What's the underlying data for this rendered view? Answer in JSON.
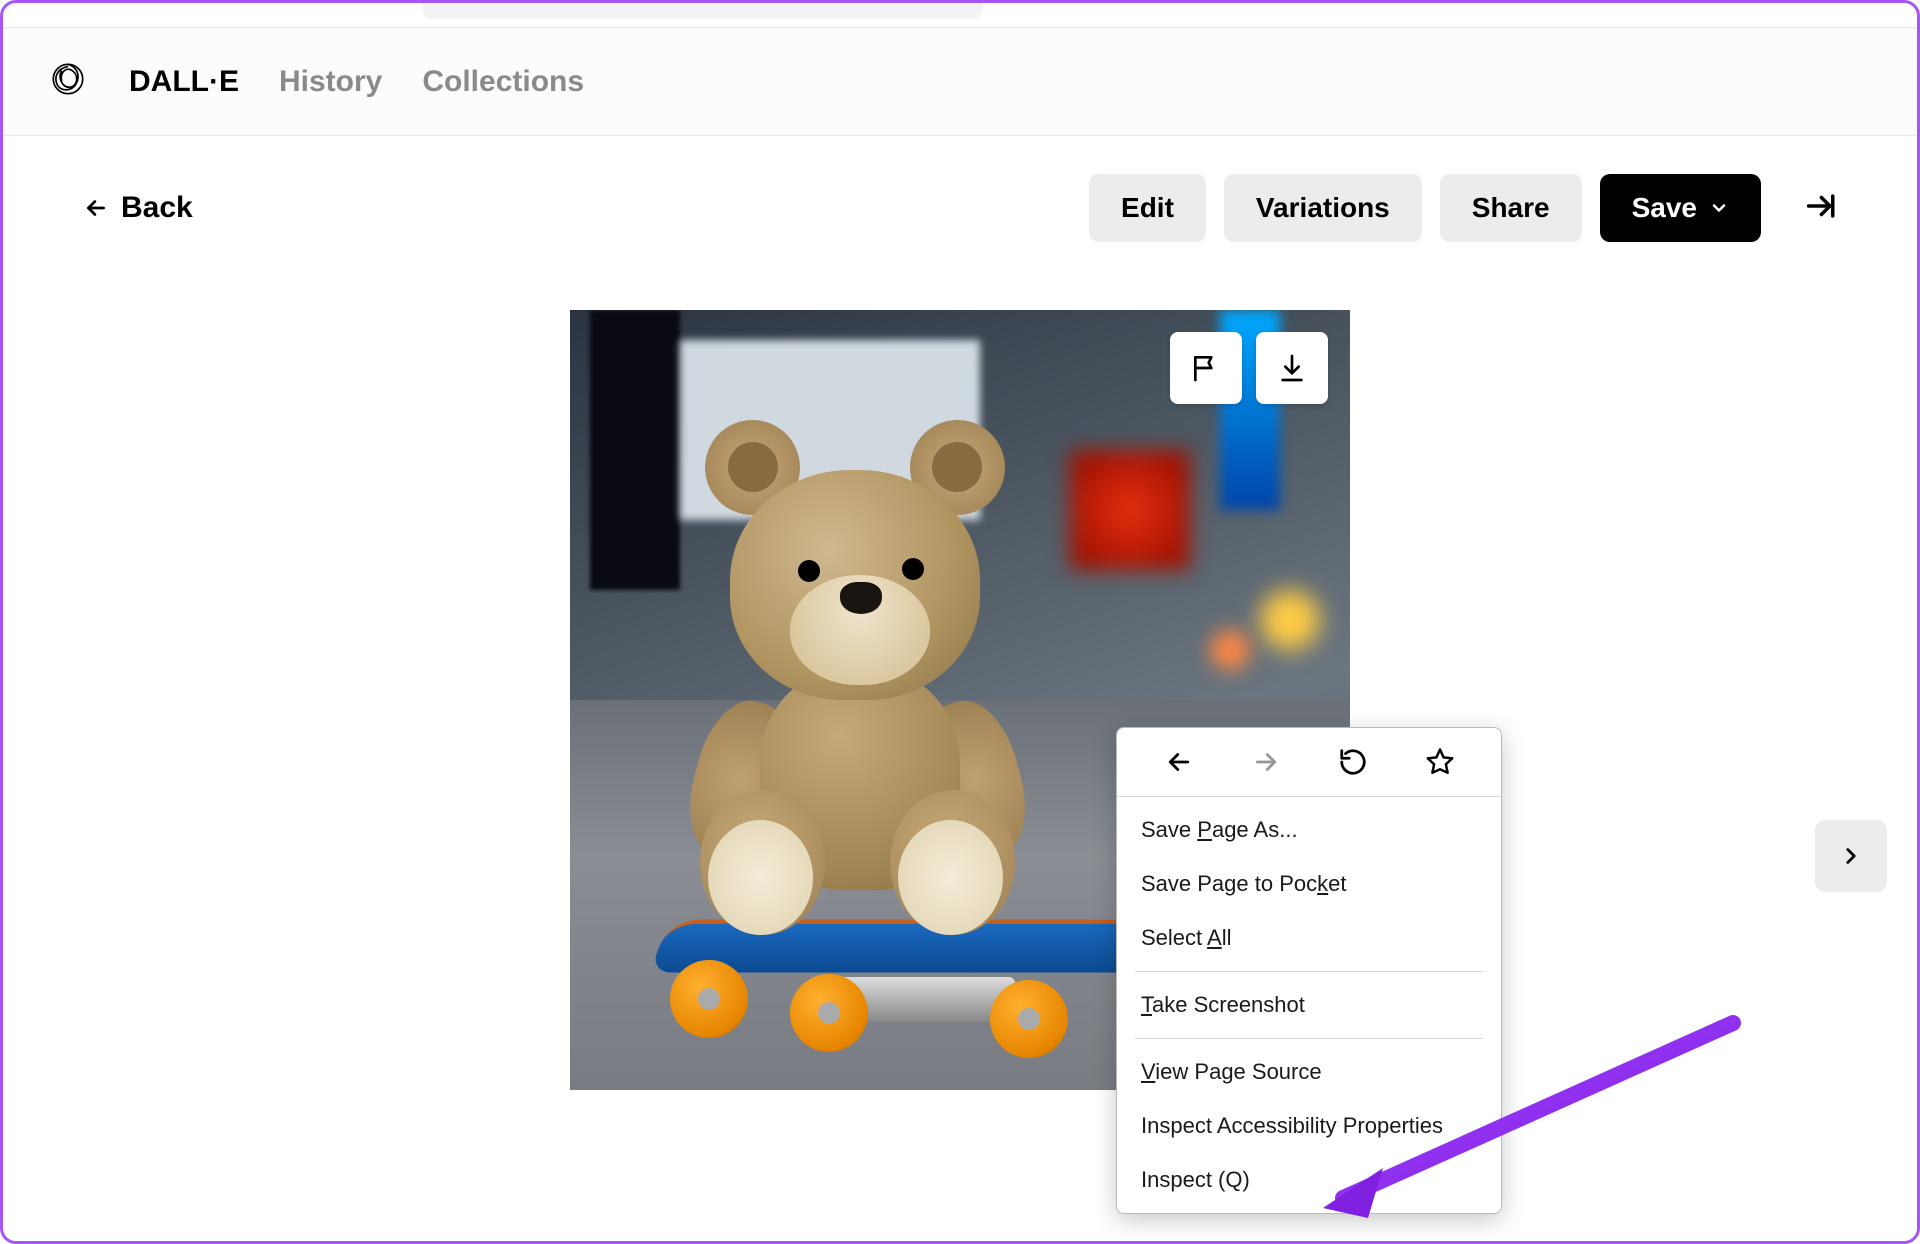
{
  "nav": {
    "brand": "DALL·E",
    "history": "History",
    "collections": "Collections"
  },
  "back_label": "Back",
  "actions": {
    "edit": "Edit",
    "variations": "Variations",
    "share": "Share",
    "save": "Save"
  },
  "overlays": {
    "flag": "flag-icon",
    "download": "download-icon"
  },
  "context_menu": {
    "save_page_as": "Save Page As...",
    "save_to_pocket": "Save Page to Pocket",
    "select_all": "Select All",
    "take_screenshot": "Take Screenshot",
    "view_source": "View Page Source",
    "inspect_a11y": "Inspect Accessibility Properties",
    "inspect": "Inspect (Q)"
  }
}
